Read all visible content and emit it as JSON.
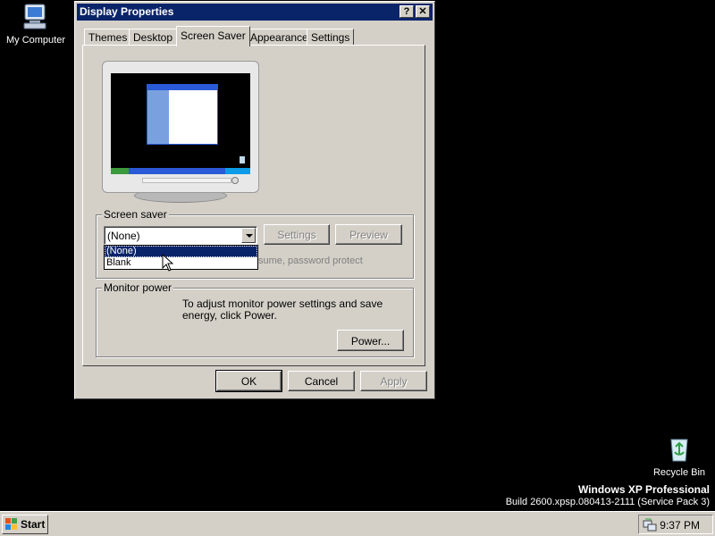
{
  "desktop": {
    "icons": [
      {
        "label": "My Computer",
        "icon": "my-computer-icon"
      },
      {
        "label": "Recycle Bin",
        "icon": "recycle-bin-icon"
      }
    ],
    "watermark": {
      "edition": "Windows XP Professional",
      "build": "Build 2600.xpsp.080413-2111 (Service Pack 3)"
    }
  },
  "window": {
    "title": "Display Properties",
    "help_label": "?",
    "close_label": "✕",
    "tabs": [
      {
        "label": "Themes",
        "active": false
      },
      {
        "label": "Desktop",
        "active": false
      },
      {
        "label": "Screen Saver",
        "active": true
      },
      {
        "label": "Appearance",
        "active": false
      },
      {
        "label": "Settings",
        "active": false
      }
    ],
    "screen_saver": {
      "group_label": "Screen saver",
      "selected": "(None)",
      "options": [
        "(None)",
        "Blank"
      ],
      "settings_label": "Settings",
      "preview_label": "Preview",
      "partial_text": "sume, password protect"
    },
    "monitor_power": {
      "group_label": "Monitor power",
      "description": "To adjust monitor power settings and save energy, click Power.",
      "power_label": "Power..."
    },
    "buttons": {
      "ok": "OK",
      "cancel": "Cancel",
      "apply": "Apply"
    },
    "colors": {
      "titlebar": "#0a246a",
      "face": "#d4d0c8",
      "selection": "#0a246a"
    }
  },
  "taskbar": {
    "start_label": "Start",
    "clock": "9:37 PM",
    "tray_icon": "network-icon"
  }
}
